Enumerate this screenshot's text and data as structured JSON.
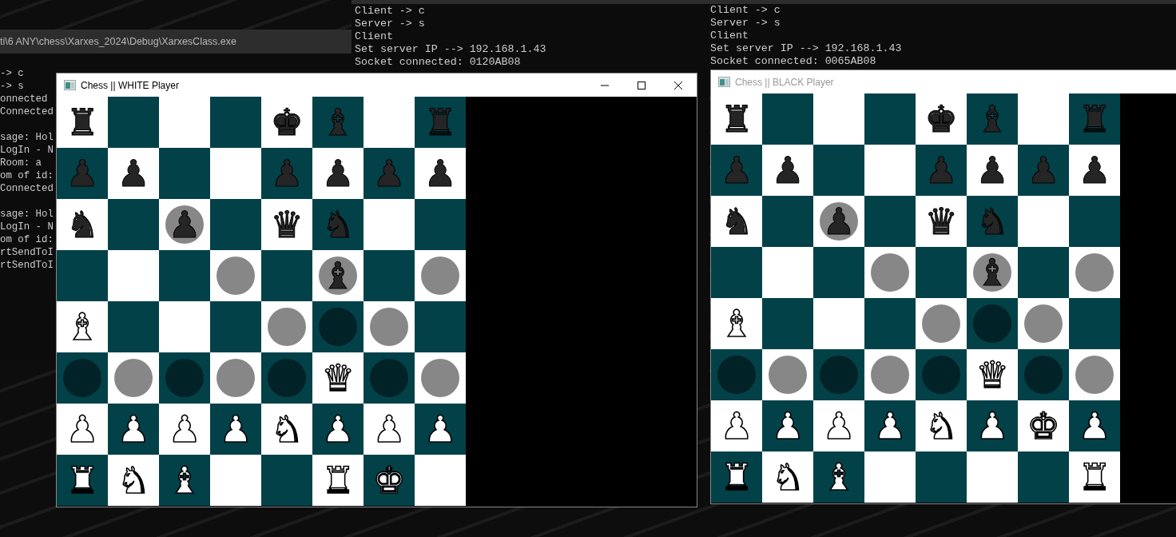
{
  "consoles": [
    {
      "title": "ti\\6 ANY\\chess\\Xarxes_2024\\Debug\\XarxesClass.exe",
      "blocks": [
        [
          "-> c",
          "-> s",
          "onnected",
          "Connected"
        ],
        [
          "sage: Hol",
          "LogIn - N",
          "Room: a",
          "om of id:",
          "Connected"
        ],
        [
          "sage: Hol",
          "LogIn - N",
          "om of id:",
          "rtSendToI",
          "rtSendToI"
        ]
      ]
    },
    {
      "blocks": [
        [
          "Client -> c",
          "Server -> s",
          "Client",
          "Set server IP --> 192.168.1.43",
          "Socket connected: 0120AB08"
        ]
      ]
    },
    {
      "blocks": [
        [
          "Client -> c",
          "Server -> s",
          "Client",
          "Set server IP --> 192.168.1.43",
          "Socket connected: 0065AB08"
        ]
      ]
    }
  ],
  "chess_windows": [
    {
      "title": "Chess || WHITE Player",
      "active": true,
      "board": [
        [
          {
            "piece": "♜",
            "white": false,
            "hint": false
          },
          {
            "hint": false
          },
          {
            "hint": false
          },
          {
            "hint": false
          },
          {
            "piece": "♚",
            "white": false,
            "hint": false
          },
          {
            "piece": "♝",
            "white": false,
            "hint": false
          },
          {
            "hint": false
          },
          {
            "piece": "♜",
            "white": false,
            "hint": false
          }
        ],
        [
          {
            "piece": "♟",
            "white": false,
            "hint": false
          },
          {
            "piece": "♟",
            "white": false,
            "hint": false
          },
          {
            "hint": false
          },
          {
            "hint": false
          },
          {
            "piece": "♟",
            "white": false,
            "hint": false
          },
          {
            "piece": "♟",
            "white": false,
            "hint": false
          },
          {
            "piece": "♟",
            "white": false,
            "hint": false
          },
          {
            "piece": "♟",
            "white": false,
            "hint": false
          }
        ],
        [
          {
            "piece": "♞",
            "white": false,
            "hint": false
          },
          {
            "hint": false
          },
          {
            "piece": "♟",
            "white": false,
            "hint": true
          },
          {
            "hint": false
          },
          {
            "piece": "♛",
            "white": false,
            "hint": false
          },
          {
            "piece": "♞",
            "white": false,
            "hint": false
          },
          {
            "hint": false
          },
          {
            "hint": false
          }
        ],
        [
          {
            "hint": false
          },
          {
            "hint": false
          },
          {
            "hint": false
          },
          {
            "hint": true
          },
          {
            "hint": false
          },
          {
            "piece": "♝",
            "white": false,
            "hint": true
          },
          {
            "hint": false
          },
          {
            "hint": true
          }
        ],
        [
          {
            "piece": "♝",
            "white": true,
            "hint": false
          },
          {
            "hint": false
          },
          {
            "hint": false
          },
          {
            "hint": false
          },
          {
            "hint": true
          },
          {
            "hint": true
          },
          {
            "hint": true
          },
          {
            "hint": false
          }
        ],
        [
          {
            "hint": true
          },
          {
            "hint": true
          },
          {
            "hint": true
          },
          {
            "hint": true
          },
          {
            "hint": true
          },
          {
            "piece": "♛",
            "white": true,
            "hint": false
          },
          {
            "hint": true
          },
          {
            "hint": true
          }
        ],
        [
          {
            "piece": "♟",
            "white": true,
            "hint": false
          },
          {
            "piece": "♟",
            "white": true,
            "hint": false
          },
          {
            "piece": "♟",
            "white": true,
            "hint": false
          },
          {
            "piece": "♟",
            "white": true,
            "hint": false
          },
          {
            "piece": "♞",
            "white": true,
            "hint": false
          },
          {
            "piece": "♟",
            "white": true,
            "hint": false
          },
          {
            "piece": "♟",
            "white": true,
            "hint": false
          },
          {
            "piece": "♟",
            "white": true,
            "hint": false
          }
        ],
        [
          {
            "piece": "♜",
            "white": true,
            "hint": false
          },
          {
            "piece": "♞",
            "white": true,
            "hint": false
          },
          {
            "piece": "♝",
            "white": true,
            "hint": false
          },
          {
            "hint": false
          },
          {
            "hint": false
          },
          {
            "piece": "♜",
            "white": true,
            "hint": false
          },
          {
            "piece": "♚",
            "white": true,
            "hint": false
          },
          {
            "hint": false
          }
        ]
      ]
    },
    {
      "title": "Chess || BLACK Player",
      "active": false,
      "board": [
        [
          {
            "piece": "♜",
            "white": false,
            "hint": false
          },
          {
            "hint": false
          },
          {
            "hint": false
          },
          {
            "hint": false
          },
          {
            "piece": "♚",
            "white": false,
            "hint": false
          },
          {
            "piece": "♝",
            "white": false,
            "hint": false
          },
          {
            "hint": false
          },
          {
            "piece": "♜",
            "white": false,
            "hint": false
          }
        ],
        [
          {
            "piece": "♟",
            "white": false,
            "hint": false
          },
          {
            "piece": "♟",
            "white": false,
            "hint": false
          },
          {
            "hint": false
          },
          {
            "hint": false
          },
          {
            "piece": "♟",
            "white": false,
            "hint": false
          },
          {
            "piece": "♟",
            "white": false,
            "hint": false
          },
          {
            "piece": "♟",
            "white": false,
            "hint": false
          },
          {
            "piece": "♟",
            "white": false,
            "hint": false
          }
        ],
        [
          {
            "piece": "♞",
            "white": false,
            "hint": false
          },
          {
            "hint": false
          },
          {
            "piece": "♟",
            "white": false,
            "hint": true
          },
          {
            "hint": false
          },
          {
            "piece": "♛",
            "white": false,
            "hint": false
          },
          {
            "piece": "♞",
            "white": false,
            "hint": false
          },
          {
            "hint": false
          },
          {
            "hint": false
          }
        ],
        [
          {
            "hint": false
          },
          {
            "hint": false
          },
          {
            "hint": false
          },
          {
            "hint": true
          },
          {
            "hint": false
          },
          {
            "piece": "♝",
            "white": false,
            "hint": true
          },
          {
            "hint": false
          },
          {
            "hint": true
          }
        ],
        [
          {
            "piece": "♝",
            "white": true,
            "hint": false
          },
          {
            "hint": false
          },
          {
            "hint": false
          },
          {
            "hint": false
          },
          {
            "hint": true
          },
          {
            "hint": true
          },
          {
            "hint": true
          },
          {
            "hint": false
          }
        ],
        [
          {
            "hint": true
          },
          {
            "hint": true
          },
          {
            "hint": true
          },
          {
            "hint": true
          },
          {
            "hint": true
          },
          {
            "piece": "♛",
            "white": true,
            "hint": false
          },
          {
            "hint": true
          },
          {
            "hint": true
          }
        ],
        [
          {
            "piece": "♟",
            "white": true,
            "hint": false
          },
          {
            "piece": "♟",
            "white": true,
            "hint": false
          },
          {
            "piece": "♟",
            "white": true,
            "hint": false
          },
          {
            "piece": "♟",
            "white": true,
            "hint": false
          },
          {
            "piece": "♞",
            "white": true,
            "hint": false
          },
          {
            "piece": "♟",
            "white": true,
            "hint": false
          },
          {
            "piece": "♚",
            "white": true,
            "hint": false
          },
          {
            "piece": "♟",
            "white": true,
            "hint": false
          }
        ],
        [
          {
            "piece": "♜",
            "white": true,
            "hint": false
          },
          {
            "piece": "♞",
            "white": true,
            "hint": false
          },
          {
            "piece": "♝",
            "white": true,
            "hint": false
          },
          {
            "hint": false
          },
          {
            "hint": false
          },
          {
            "hint": false
          },
          {
            "hint": false
          },
          {
            "piece": "♜",
            "white": true,
            "hint": false
          }
        ]
      ]
    }
  ]
}
